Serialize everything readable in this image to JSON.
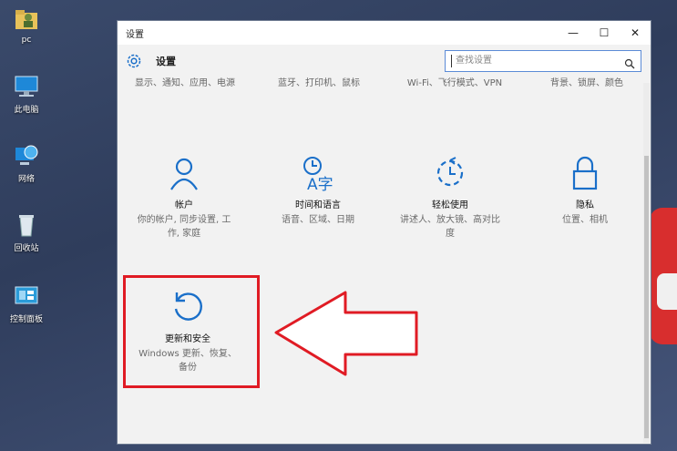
{
  "desktop": {
    "icons": [
      {
        "label": "pc",
        "icon": "folder-user-icon"
      },
      {
        "label": "此电脑",
        "icon": "computer-icon"
      },
      {
        "label": "网络",
        "icon": "network-globe-icon"
      },
      {
        "label": "回收站",
        "icon": "recycle-bin-icon"
      },
      {
        "label": "控制面板",
        "icon": "control-panel-icon"
      }
    ]
  },
  "window": {
    "title": "设置",
    "controls": {
      "minimize": "—",
      "maximize": "☐",
      "close": "✕"
    }
  },
  "header": {
    "app_title": "设置",
    "search_placeholder": "查找设置"
  },
  "top_row": [
    {
      "text": "显示、通知、应用、电源"
    },
    {
      "text": "蓝牙、打印机、鼠标"
    },
    {
      "text": "Wi-Fi、飞行模式、VPN"
    },
    {
      "text": "背景、锁屏、颜色"
    }
  ],
  "tiles": [
    {
      "name": "帐户",
      "desc": "你的帐户, 同步设置, 工作, 家庭",
      "icon": "account-person-icon"
    },
    {
      "name": "时间和语言",
      "desc": "语音、区域、日期",
      "icon": "time-language-icon"
    },
    {
      "name": "轻松使用",
      "desc": "讲述人、放大镜、高对比度",
      "icon": "ease-of-access-icon"
    },
    {
      "name": "隐私",
      "desc": "位置、相机",
      "icon": "lock-icon"
    },
    {
      "name": "更新和安全",
      "desc": "Windows 更新、恢复、备份",
      "icon": "update-refresh-icon"
    }
  ],
  "colors": {
    "accent": "#1a6fc9",
    "highlight": "#e01b24"
  }
}
